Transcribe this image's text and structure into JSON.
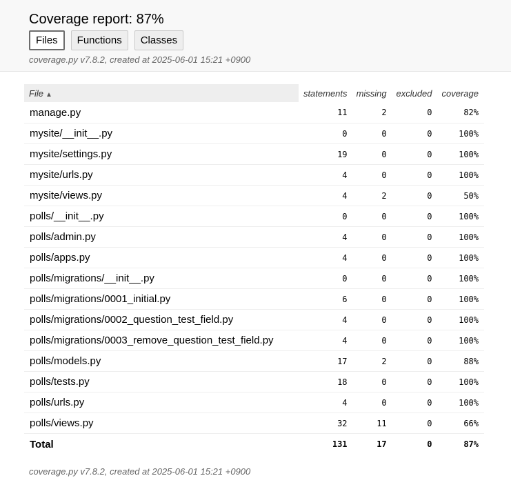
{
  "header": {
    "title": "Coverage report: 87%",
    "tabs": [
      {
        "label": "Files",
        "active": true
      },
      {
        "label": "Functions",
        "active": false
      },
      {
        "label": "Classes",
        "active": false
      }
    ],
    "meta": "coverage.py v7.8.2, created at 2025-06-01 15:21 +0900"
  },
  "table": {
    "columns": [
      "File",
      "statements",
      "missing",
      "excluded",
      "coverage"
    ],
    "sort_indicator": "▲",
    "rows": [
      [
        "manage.py",
        "11",
        "2",
        "0",
        "82%"
      ],
      [
        "mysite/__init__.py",
        "0",
        "0",
        "0",
        "100%"
      ],
      [
        "mysite/settings.py",
        "19",
        "0",
        "0",
        "100%"
      ],
      [
        "mysite/urls.py",
        "4",
        "0",
        "0",
        "100%"
      ],
      [
        "mysite/views.py",
        "4",
        "2",
        "0",
        "50%"
      ],
      [
        "polls/__init__.py",
        "0",
        "0",
        "0",
        "100%"
      ],
      [
        "polls/admin.py",
        "4",
        "0",
        "0",
        "100%"
      ],
      [
        "polls/apps.py",
        "4",
        "0",
        "0",
        "100%"
      ],
      [
        "polls/migrations/__init__.py",
        "0",
        "0",
        "0",
        "100%"
      ],
      [
        "polls/migrations/0001_initial.py",
        "6",
        "0",
        "0",
        "100%"
      ],
      [
        "polls/migrations/0002_question_test_field.py",
        "4",
        "0",
        "0",
        "100%"
      ],
      [
        "polls/migrations/0003_remove_question_test_field.py",
        "4",
        "0",
        "0",
        "100%"
      ],
      [
        "polls/models.py",
        "17",
        "2",
        "0",
        "88%"
      ],
      [
        "polls/tests.py",
        "18",
        "0",
        "0",
        "100%"
      ],
      [
        "polls/urls.py",
        "4",
        "0",
        "0",
        "100%"
      ],
      [
        "polls/views.py",
        "32",
        "11",
        "0",
        "66%"
      ]
    ],
    "total": [
      "Total",
      "131",
      "17",
      "0",
      "87%"
    ]
  },
  "footer": {
    "meta": "coverage.py v7.8.2, created at 2025-06-01 15:21 +0900"
  }
}
